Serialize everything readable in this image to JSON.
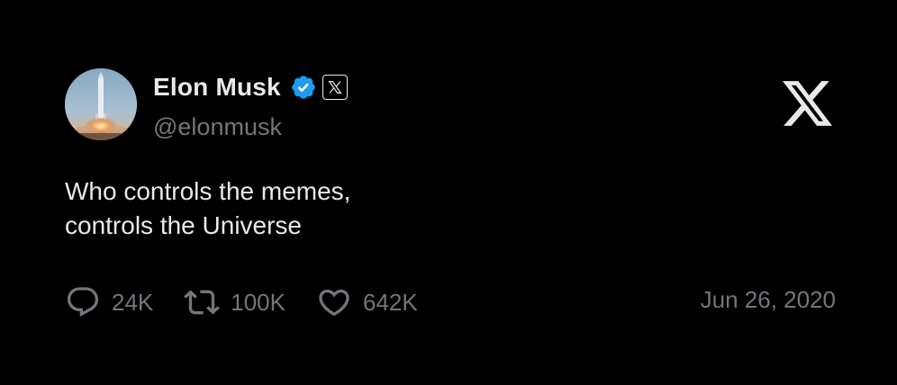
{
  "author": {
    "display_name": "Elon Musk",
    "handle": "@elonmusk",
    "verified": true,
    "verified_badge_icon": "verified-check-icon",
    "affiliation_badge_icon": "x-logo-icon",
    "avatar_icon": "rocket-launch-avatar"
  },
  "tweet": {
    "text_lines": [
      "Who controls the memes,",
      "controls the Universe"
    ],
    "date": "Jun 26, 2020"
  },
  "actions": {
    "replies": {
      "icon": "reply-bubble-icon",
      "count": "24K"
    },
    "reposts": {
      "icon": "repost-arrows-icon",
      "count": "100K"
    },
    "likes": {
      "icon": "heart-icon",
      "count": "642K"
    }
  },
  "brand": {
    "logo_icon": "x-logo-icon"
  },
  "colors": {
    "background": "#000000",
    "primary_text": "#e7e9ea",
    "secondary_text": "#71767b",
    "verified_blue": "#1d9bf0"
  }
}
